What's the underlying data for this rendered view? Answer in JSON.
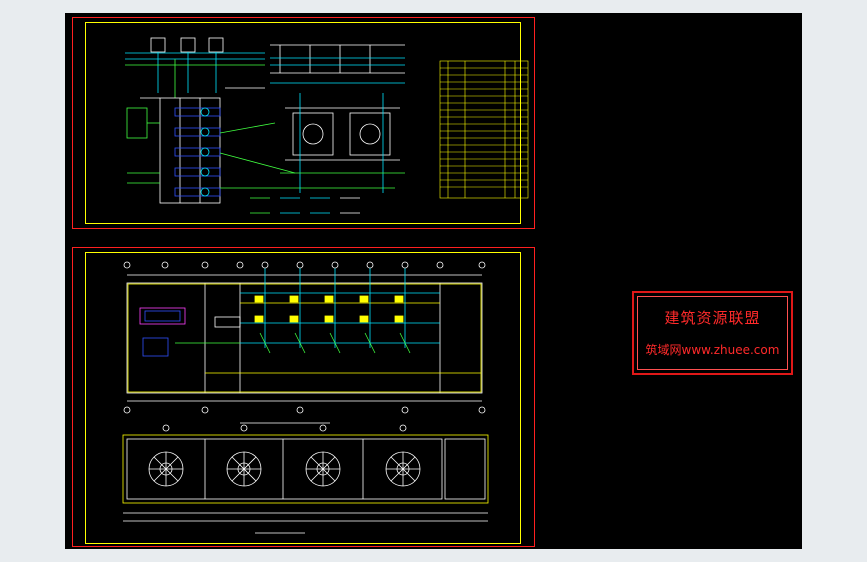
{
  "watermark": {
    "title": "建筑资源联盟",
    "subtitle": "筑域网www.zhuee.com"
  },
  "colors": {
    "background": "#E8ECEF",
    "canvas": "#000000",
    "frame": "#FF2020",
    "border": "#FFFF00",
    "line_cyan": "#00E5FF",
    "line_green": "#40FF40",
    "line_blue": "#3050FF",
    "line_white": "#FFFFFF",
    "line_magenta": "#FF40FF"
  }
}
